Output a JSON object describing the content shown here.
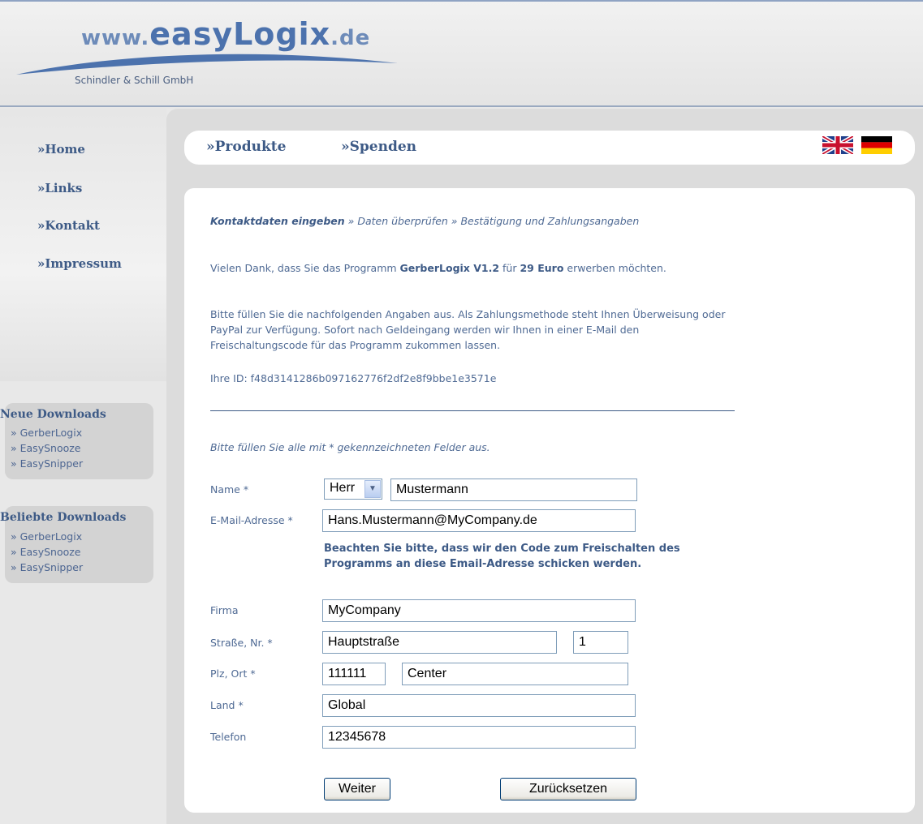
{
  "header": {
    "logo_www": "www.",
    "logo_brand": "easyLogix",
    "logo_tld": ".de",
    "company": "Schindler & Schill GmbH"
  },
  "sidebar": {
    "nav": [
      "»Home",
      "»Links",
      "»Kontakt",
      "»Impressum"
    ],
    "new_downloads": {
      "title": "Neue Downloads",
      "items": [
        "» GerberLogix",
        "» EasySnooze",
        "» EasySnipper"
      ]
    },
    "popular_downloads": {
      "title": "Beliebte Downloads",
      "items": [
        "» GerberLogix",
        "» EasySnooze",
        "» EasySnipper"
      ]
    }
  },
  "topnav": {
    "items": [
      "»Produkte",
      "»Spenden"
    ],
    "flags": [
      "uk-flag-icon",
      "de-flag-icon"
    ]
  },
  "content": {
    "breadcrumb": {
      "active": "Kontaktdaten eingeben",
      "rest": " » Daten überprüfen » Bestätigung und Zahlungsangaben"
    },
    "intro_part1": "Vielen Dank, dass Sie das Programm ",
    "program_name": "GerberLogix V1.2",
    "intro_part2": " für ",
    "price": "29 Euro",
    "intro_part3": " erwerben möchten.",
    "info": "Bitte füllen Sie die nachfolgenden Angaben aus. Als Zahlungsmethode steht Ihnen Überweisung oder PayPal zur Verfügung. Sofort nach Geldeingang werden wir Ihnen in einer E-Mail den Freischaltungscode für das Programm zukommen lassen.",
    "id_line": "Ihre ID: f48d3141286b097162776f2df2e8f9bbe1e3571e",
    "required_hint": "Bitte füllen Sie alle mit * gekennzeichneten Felder aus."
  },
  "form": {
    "name_label": "Name *",
    "salutation": "Herr",
    "name_value": "Mustermann",
    "email_label": "E-Mail-Adresse *",
    "email_value": "Hans.Mustermann@MyCompany.de",
    "email_note": "Beachten Sie bitte, dass wir den Code zum Freischalten des Programms an diese Email-Adresse schicken werden.",
    "company_label": "Firma",
    "company_value": "MyCompany",
    "street_label": "Straße, Nr. *",
    "street_value": "Hauptstraße",
    "number_value": "1",
    "city_label": "Plz, Ort *",
    "zip_value": "111111",
    "city_value": "Center",
    "country_label": "Land *",
    "country_value": "Global",
    "phone_label": "Telefon",
    "phone_value": "12345678",
    "submit_label": "Weiter",
    "reset_label": "Zurücksetzen"
  }
}
